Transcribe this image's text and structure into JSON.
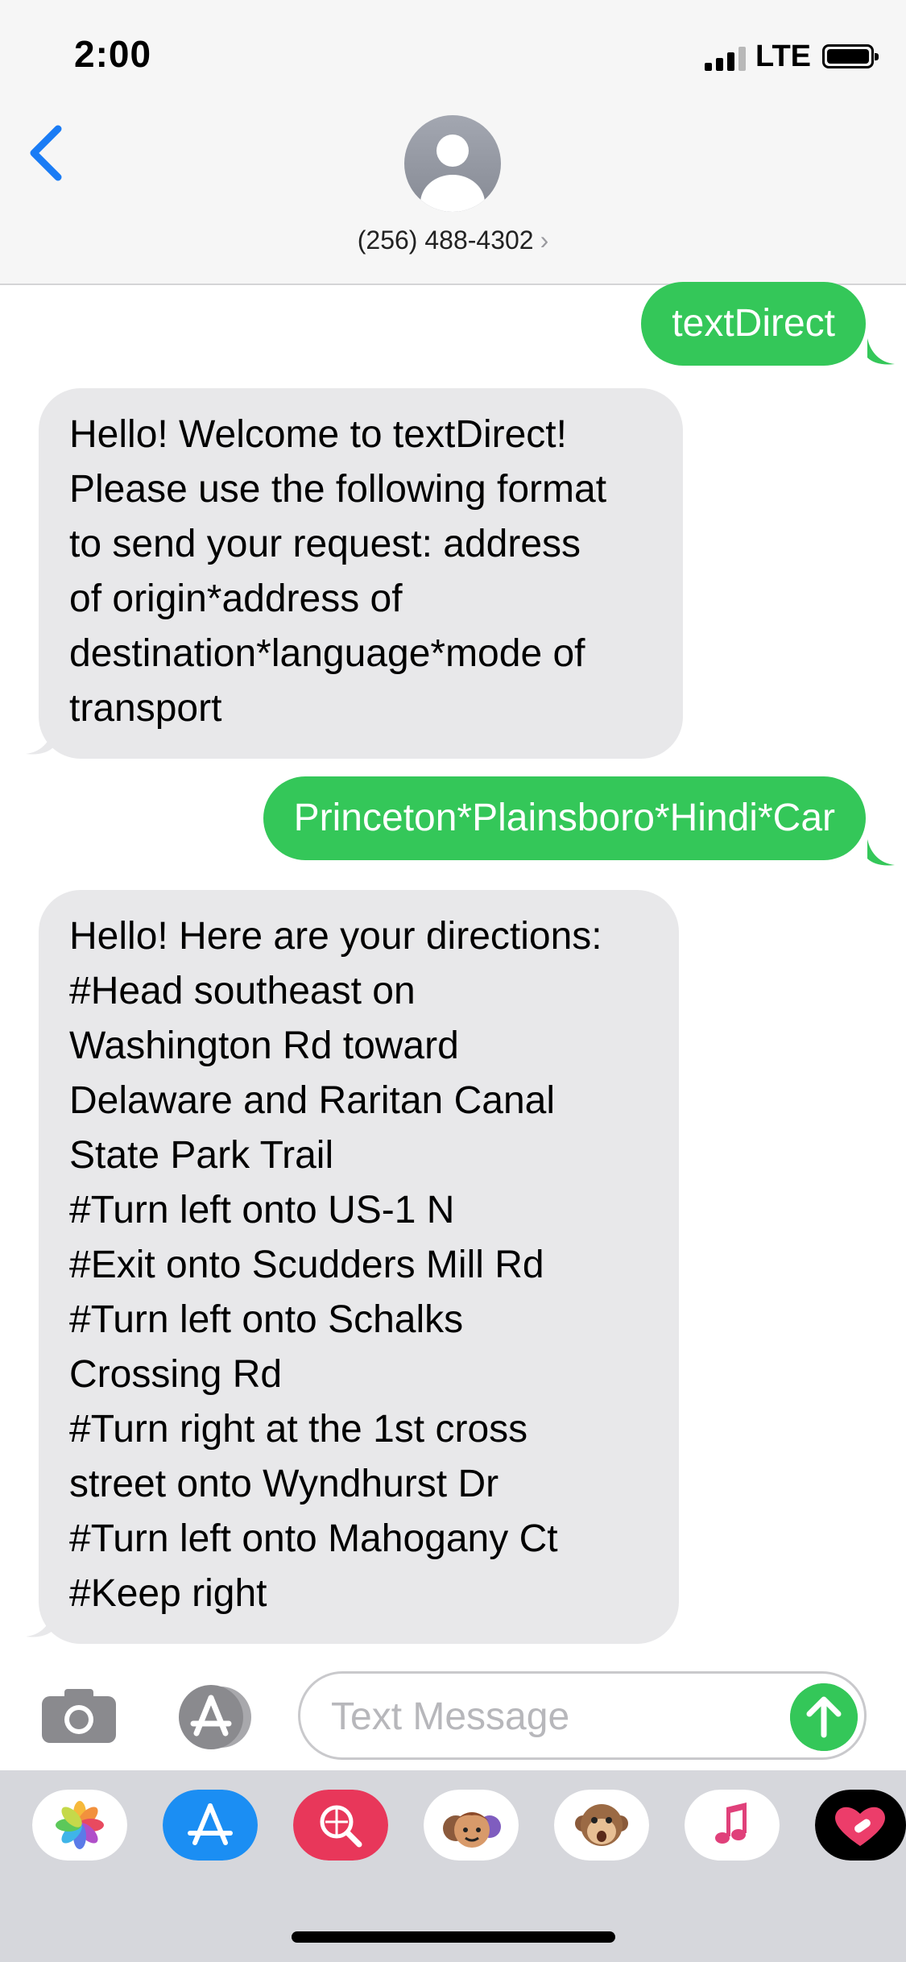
{
  "status_bar": {
    "time": "2:00",
    "network": "LTE"
  },
  "header": {
    "contact": "(256) 488-4302",
    "chevron": "›"
  },
  "messages": [
    {
      "direction": "sent",
      "lines": [
        "textDirect"
      ]
    },
    {
      "direction": "received",
      "lines": [
        "Hello! Welcome to textDirect!",
        "Please use the following format",
        "to send your request: address",
        "of origin*address of",
        "destination*language*mode of",
        "transport"
      ]
    },
    {
      "direction": "sent",
      "lines": [
        "Princeton*Plainsboro*Hindi*Car"
      ]
    },
    {
      "direction": "received",
      "lines": [
        "Hello! Here are your directions:",
        "#Head southeast on",
        "Washington Rd toward",
        "Delaware and Raritan Canal",
        "State Park Trail",
        "#Turn left onto US-1 N",
        "#Exit onto Scudders Mill Rd",
        "#Turn left onto Schalks",
        "Crossing Rd",
        "#Turn right at the 1st cross",
        "street onto Wyndhurst Dr",
        "#Turn left onto Mahogany Ct",
        "#Keep right"
      ]
    }
  ],
  "input": {
    "placeholder": "Text Message"
  },
  "app_drawer": [
    "photos-icon",
    "app-store-icon",
    "web-search-icon",
    "memoji-icon",
    "animoji-icon",
    "music-icon",
    "digital-touch-icon"
  ],
  "colors": {
    "sent_bubble": "#34c759",
    "received_bubble": "#e8e8ea",
    "ios_blue": "#1a7cf5"
  }
}
